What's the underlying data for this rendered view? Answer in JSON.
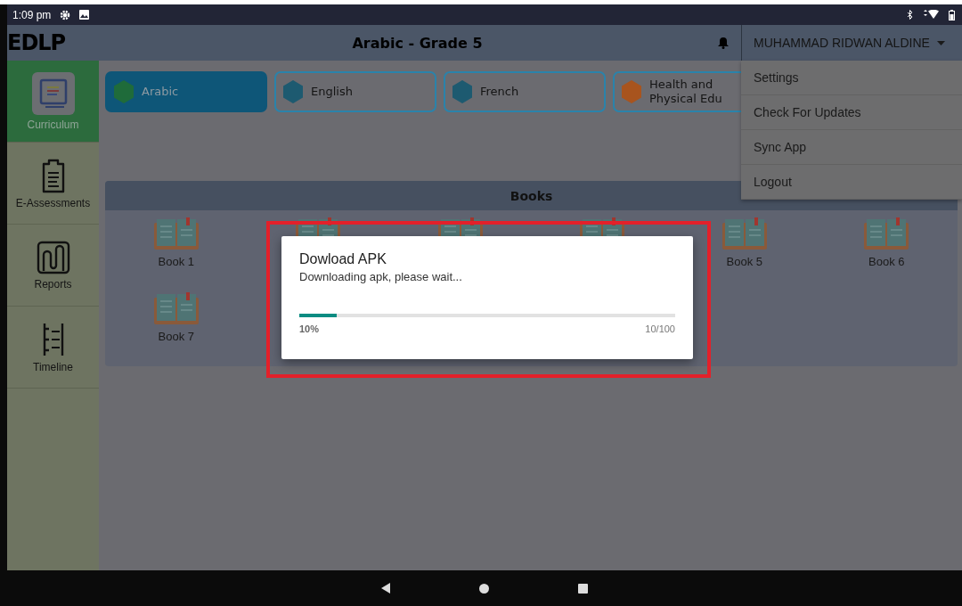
{
  "status_bar": {
    "time": "1:09 pm"
  },
  "header": {
    "logo": "EDLP",
    "title": "Arabic - Grade 5",
    "user": "MUHAMMAD RIDWAN ALDINE"
  },
  "sidebar": {
    "items": [
      {
        "label": "Curriculum",
        "kind": "curriculum",
        "selected": true
      },
      {
        "label": "E-Assessments",
        "kind": "assessment",
        "selected": false
      },
      {
        "label": "Reports",
        "kind": "reports",
        "selected": false
      },
      {
        "label": "Timeline",
        "kind": "timeline",
        "selected": false
      }
    ]
  },
  "subject_tabs": [
    {
      "label": "Arabic",
      "color": "#1f6b3a",
      "selected": true
    },
    {
      "label": "English",
      "color": "#1d5a70",
      "selected": false
    },
    {
      "label": "French",
      "color": "#1d5a70",
      "selected": false
    },
    {
      "label": "Health and Physical Edu",
      "color": "#a8541e",
      "selected": false
    }
  ],
  "books": {
    "title": "Books",
    "items": [
      {
        "kind": "book",
        "label": "Book 1"
      },
      {
        "kind": "covered"
      },
      {
        "kind": "covered"
      },
      {
        "kind": "covered"
      },
      {
        "kind": "book",
        "label": "Book 5"
      },
      {
        "kind": "book",
        "label": "Book 6"
      },
      {
        "kind": "book",
        "label": "Book 7"
      }
    ]
  },
  "user_menu": {
    "items": [
      "Settings",
      "Check For Updates",
      "Sync App",
      "Logout"
    ]
  },
  "dialog": {
    "title": "Dowload APK",
    "message": "Downloading apk, please wait...",
    "level": 0.1,
    "percent": "10%",
    "count": "10/100"
  }
}
